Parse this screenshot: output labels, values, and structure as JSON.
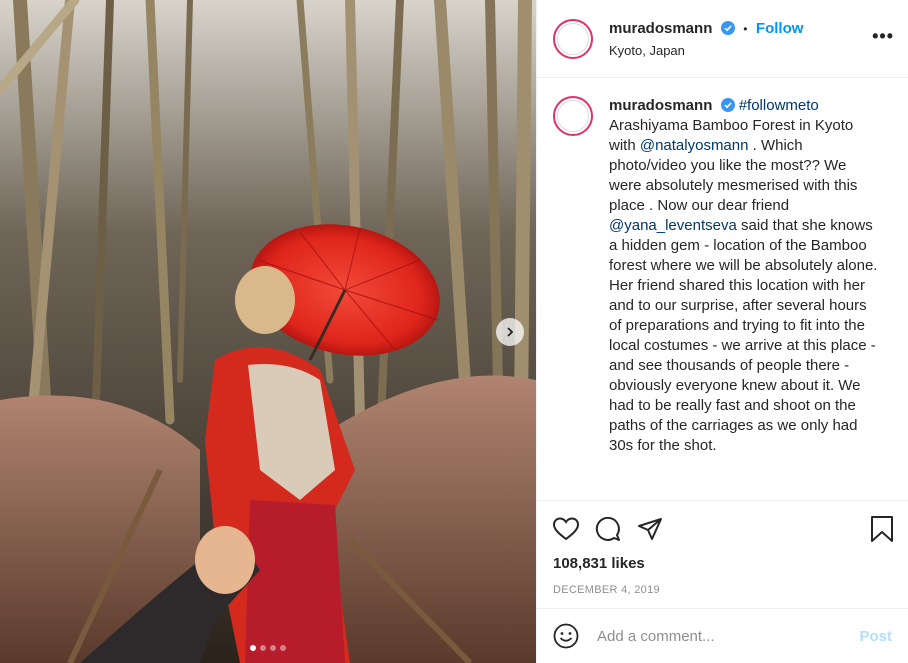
{
  "post": {
    "username": "muradosmann",
    "follow_label": "Follow",
    "separator": "•",
    "location": "Kyoto, Japan",
    "more_label": "•••",
    "verified_icon": "verified-badge-icon"
  },
  "caption": {
    "username": "muradosmann",
    "hashtag": "#followmeto",
    "text_1": "Arashiyama Bamboo Forest in Kyoto with ",
    "mention_1": "@natalyosmann",
    "text_2": " . Which photo/video you like the most?? We were absolutely mesmerised with this place . Now our dear friend ",
    "mention_2": "@yana_leventseva",
    "text_3": " said that she knows a hidden gem - location of the Bamboo forest where we will be absolutely alone. Her friend shared this location with her and to our surprise, after several hours of preparations and trying to fit into the local costumes - we arrive at this place - and see thousands of people there - obviously everyone knew about it. We had to be really fast and shoot on the paths of the carriages as we only had 30s for the shot."
  },
  "stats": {
    "likes": "108,831 likes",
    "date": "DECEMBER 4, 2019"
  },
  "comment_box": {
    "placeholder": "Add a comment...",
    "post_label": "Post"
  },
  "carousel": {
    "slide_count": 4,
    "active_index": 0
  },
  "colors": {
    "accent": "#0095f6",
    "link": "#00376b",
    "post_disabled": "#b2dffc"
  }
}
